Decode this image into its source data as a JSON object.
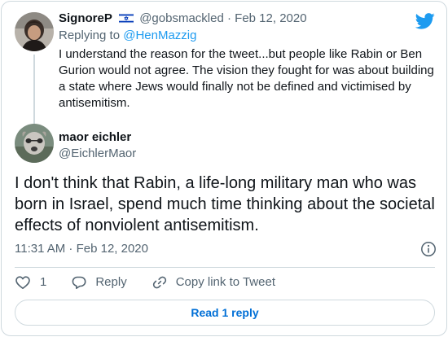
{
  "parent_tweet": {
    "author_name": "SignoreP",
    "flag_icon": "israel-flag-icon",
    "handle": "@gobsmackled",
    "separator": "·",
    "date": "Feb 12, 2020",
    "replying_prefix": "Replying to ",
    "replying_to": "@HenMazzig",
    "text": "I understand the reason for the tweet...but people like Rabin or Ben Gurion would not agree. The vision they fought for was about building a  state where Jews would finally not be defined and victimised by antisemitism."
  },
  "main_tweet": {
    "author_name": "maor eichler",
    "handle": "@EichlerMaor",
    "text": "I don't think that Rabin, a life-long military man who was born in Israel, spend much time thinking about the societal effects of nonviolent antisemitism.",
    "timestamp": "11:31 AM · Feb 12, 2020",
    "like_count": "1",
    "reply_label": "Reply",
    "copy_link_label": "Copy link to Tweet",
    "read_replies_label": "Read 1 reply"
  },
  "colors": {
    "accent": "#1d9bf0",
    "like_red": "#f91880",
    "text_primary": "#0f1419",
    "text_secondary": "#536471",
    "border": "#cfd9de"
  }
}
